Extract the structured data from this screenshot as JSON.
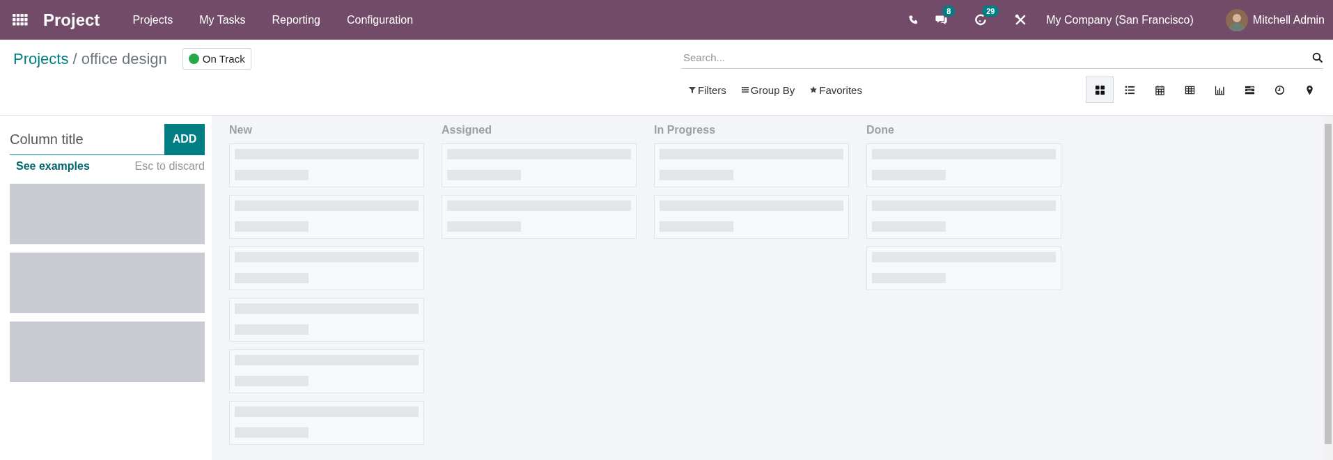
{
  "navbar": {
    "app_name": "Project",
    "menu": [
      "Projects",
      "My Tasks",
      "Reporting",
      "Configuration"
    ],
    "messages_count": "8",
    "activities_count": "29",
    "company": "My Company (San Francisco)",
    "user": "Mitchell Admin"
  },
  "breadcrumb": {
    "parent": "Projects",
    "separator": "/",
    "current": "office design"
  },
  "status": {
    "label": "On Track",
    "color": "#28a745"
  },
  "search": {
    "placeholder": "Search..."
  },
  "filters": [
    "Filters",
    "Group By",
    "Favorites"
  ],
  "views": [
    {
      "kind": "kanban",
      "selected": true
    },
    {
      "kind": "list",
      "selected": false
    },
    {
      "kind": "calendar",
      "selected": false
    },
    {
      "kind": "pivot",
      "selected": false
    },
    {
      "kind": "graph",
      "selected": false
    },
    {
      "kind": "gantt",
      "selected": false
    },
    {
      "kind": "activity",
      "selected": false
    },
    {
      "kind": "map",
      "selected": false
    }
  ],
  "quick_create": {
    "placeholder": "Column title",
    "button": "ADD",
    "examples_link": "See examples",
    "hint": "Esc to discard"
  },
  "columns": [
    {
      "title": "New",
      "cards": [
        {
          "kind": "placeholder"
        },
        {
          "kind": "placeholder"
        },
        {
          "kind": "placeholder"
        },
        {
          "kind": "placeholder"
        },
        {
          "kind": "placeholder"
        },
        {
          "kind": "placeholder"
        }
      ]
    },
    {
      "title": "Assigned",
      "cards": [
        {
          "kind": "placeholder"
        },
        {
          "kind": "placeholder"
        }
      ]
    },
    {
      "title": "In Progress",
      "cards": [
        {
          "kind": "placeholder"
        },
        {
          "kind": "placeholder"
        }
      ]
    },
    {
      "title": "Done",
      "cards": [
        {
          "kind": "placeholder"
        },
        {
          "kind": "placeholder"
        },
        {
          "kind": "placeholder"
        }
      ]
    }
  ]
}
